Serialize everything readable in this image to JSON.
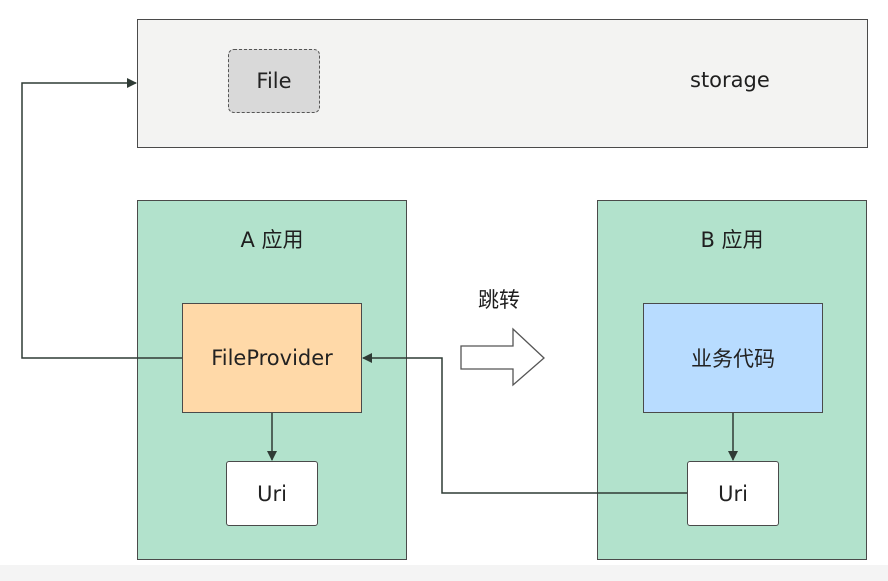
{
  "storage": {
    "label": "storage",
    "file_label": "File"
  },
  "app_a": {
    "title": "A 应用",
    "provider_label": "FileProvider",
    "uri_label": "Uri"
  },
  "app_b": {
    "title": "B 应用",
    "code_label": "业务代码",
    "uri_label": "Uri"
  },
  "transition": {
    "label": "跳转"
  },
  "colors": {
    "storage_bg": "#f3f3f2",
    "file_bg": "#d9d9d9",
    "app_bg": "#b2e2cc",
    "provider_bg": "#ffd9a8",
    "code_bg": "#b8dcff",
    "uri_bg": "#ffffff",
    "line": "#2f3b35"
  }
}
